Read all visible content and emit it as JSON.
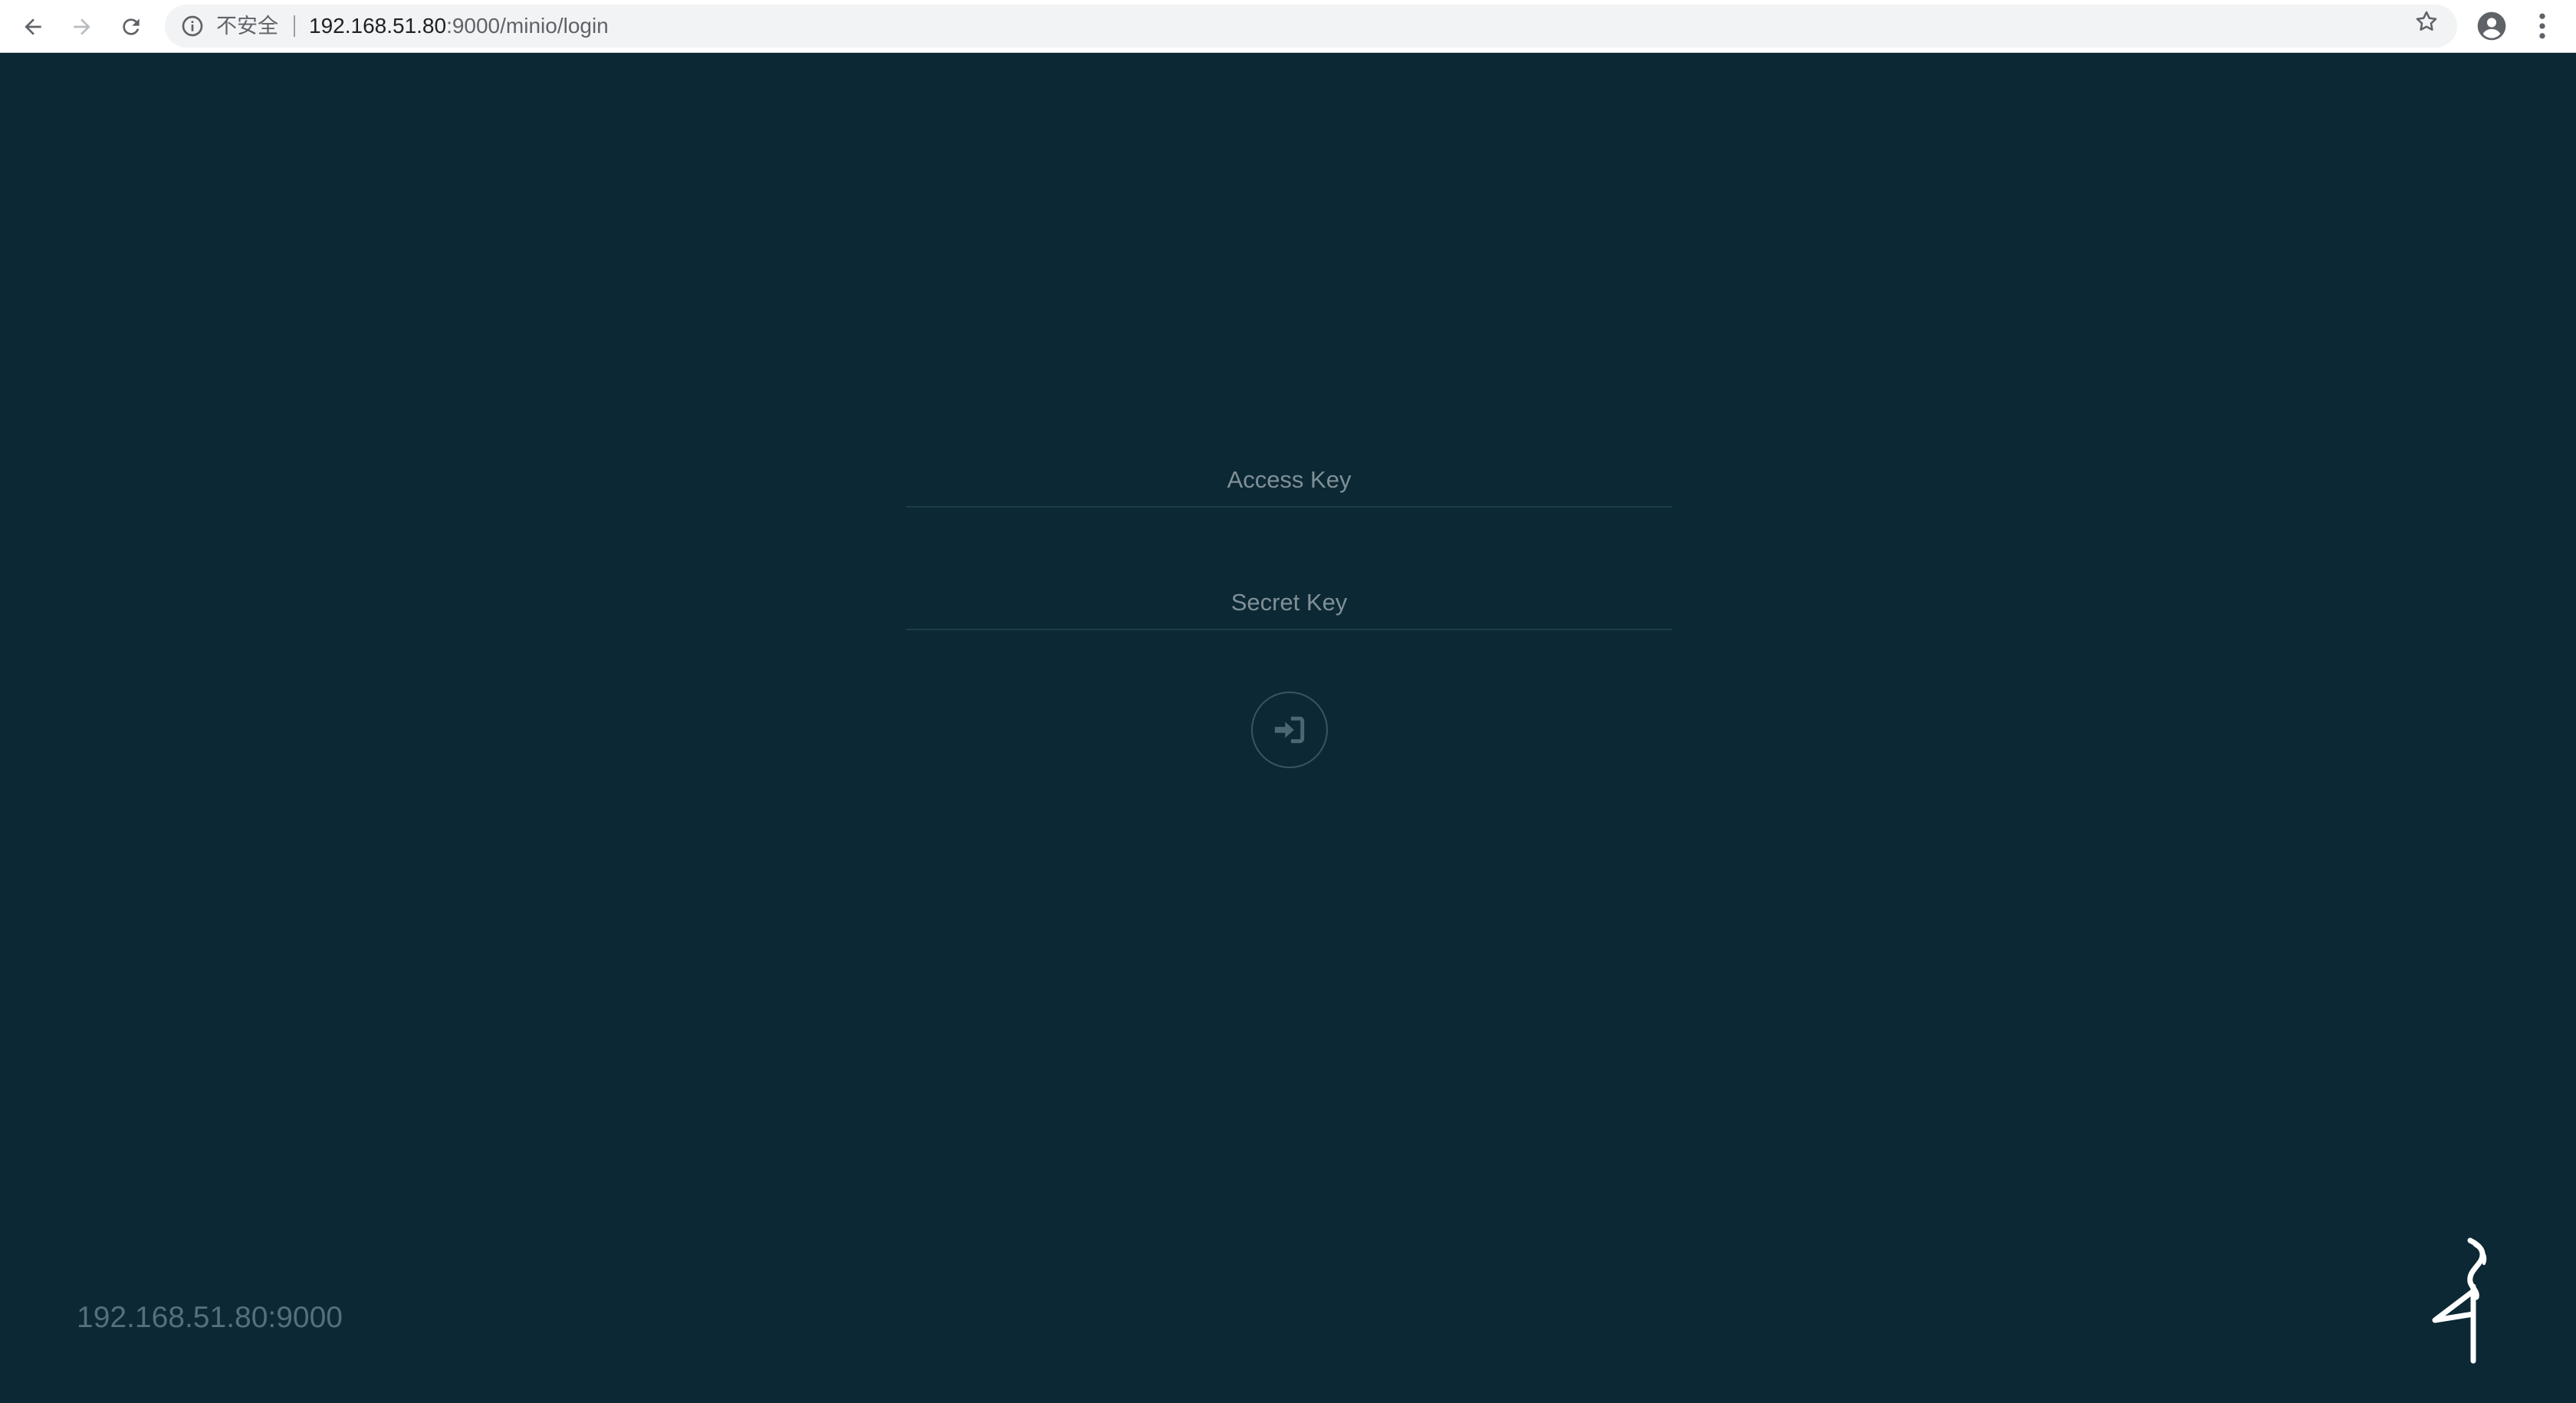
{
  "browser": {
    "security_label": "不安全",
    "url_host": "192.168.51.80",
    "url_rest": ":9000/minio/login",
    "icons": [
      "back-arrow-icon",
      "forward-arrow-icon",
      "reload-icon",
      "info-icon",
      "star-icon",
      "profile-icon",
      "more-menu-icon"
    ]
  },
  "login": {
    "access_key_placeholder": "Access Key",
    "secret_key_placeholder": "Secret Key",
    "submit_icon": "sign-in-icon"
  },
  "footer": {
    "host": "192.168.51.80:9000",
    "logo": "minio-logo"
  },
  "colors": {
    "background": "#0c2834",
    "field_line": "#1c3d4b",
    "host_text": "#53707c"
  }
}
